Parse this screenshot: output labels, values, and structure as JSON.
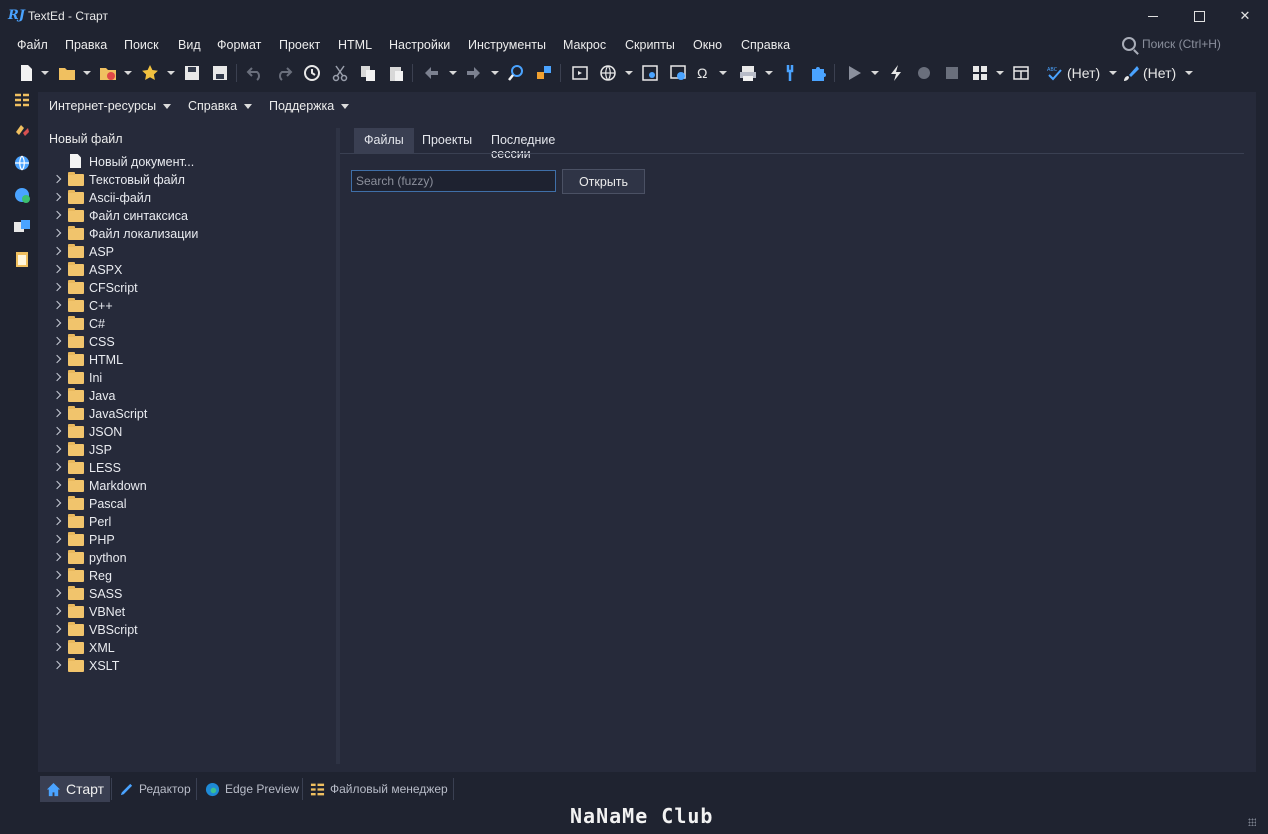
{
  "window": {
    "title": "TextEd - Старт",
    "logo": "RJ"
  },
  "menubar": {
    "items": [
      "Файл",
      "Правка",
      "Поиск",
      "Вид",
      "Формат",
      "Проект",
      "HTML",
      "Настройки",
      "Инструменты",
      "Макрос",
      "Скрипты",
      "Окно",
      "Справка"
    ],
    "search_placeholder": "Поиск (Ctrl+H)"
  },
  "toolbar": {
    "spell_label": "(Нет)",
    "brush_label": "(Нет)"
  },
  "submenu": {
    "items": [
      "Интернет-ресурсы",
      "Справка",
      "Поддержка"
    ]
  },
  "tree": {
    "header": "Новый файл",
    "new_document": "Новый документ...",
    "folders": [
      "Текстовый файл",
      "Ascii-файл",
      "Файл синтаксиса",
      "Файл локализации",
      "ASP",
      "ASPX",
      "CFScript",
      "C++",
      "C#",
      "CSS",
      "HTML",
      "Ini",
      "Java",
      "JavaScript",
      "JSON",
      "JSP",
      "LESS",
      "Markdown",
      "Pascal",
      "Perl",
      "PHP",
      "python",
      "Reg",
      "SASS",
      "VBNet",
      "VBScript",
      "XML",
      "XSLT"
    ]
  },
  "tabs": {
    "items": [
      "Файлы",
      "Проекты",
      "Последние сессии"
    ],
    "active": "Файлы"
  },
  "files": {
    "search_placeholder": "Search (fuzzy)",
    "open_label": "Открыть"
  },
  "bottom_tabs": {
    "items": [
      "Старт",
      "Редактор",
      "Edge Preview",
      "Файловый менеджер"
    ],
    "active": "Старт"
  },
  "watermark": "NaNaMe Club",
  "colors": {
    "background": "#1f2330",
    "panel": "#262a3a",
    "accent": "#3f6fa8",
    "folder": "#f1c46c"
  }
}
